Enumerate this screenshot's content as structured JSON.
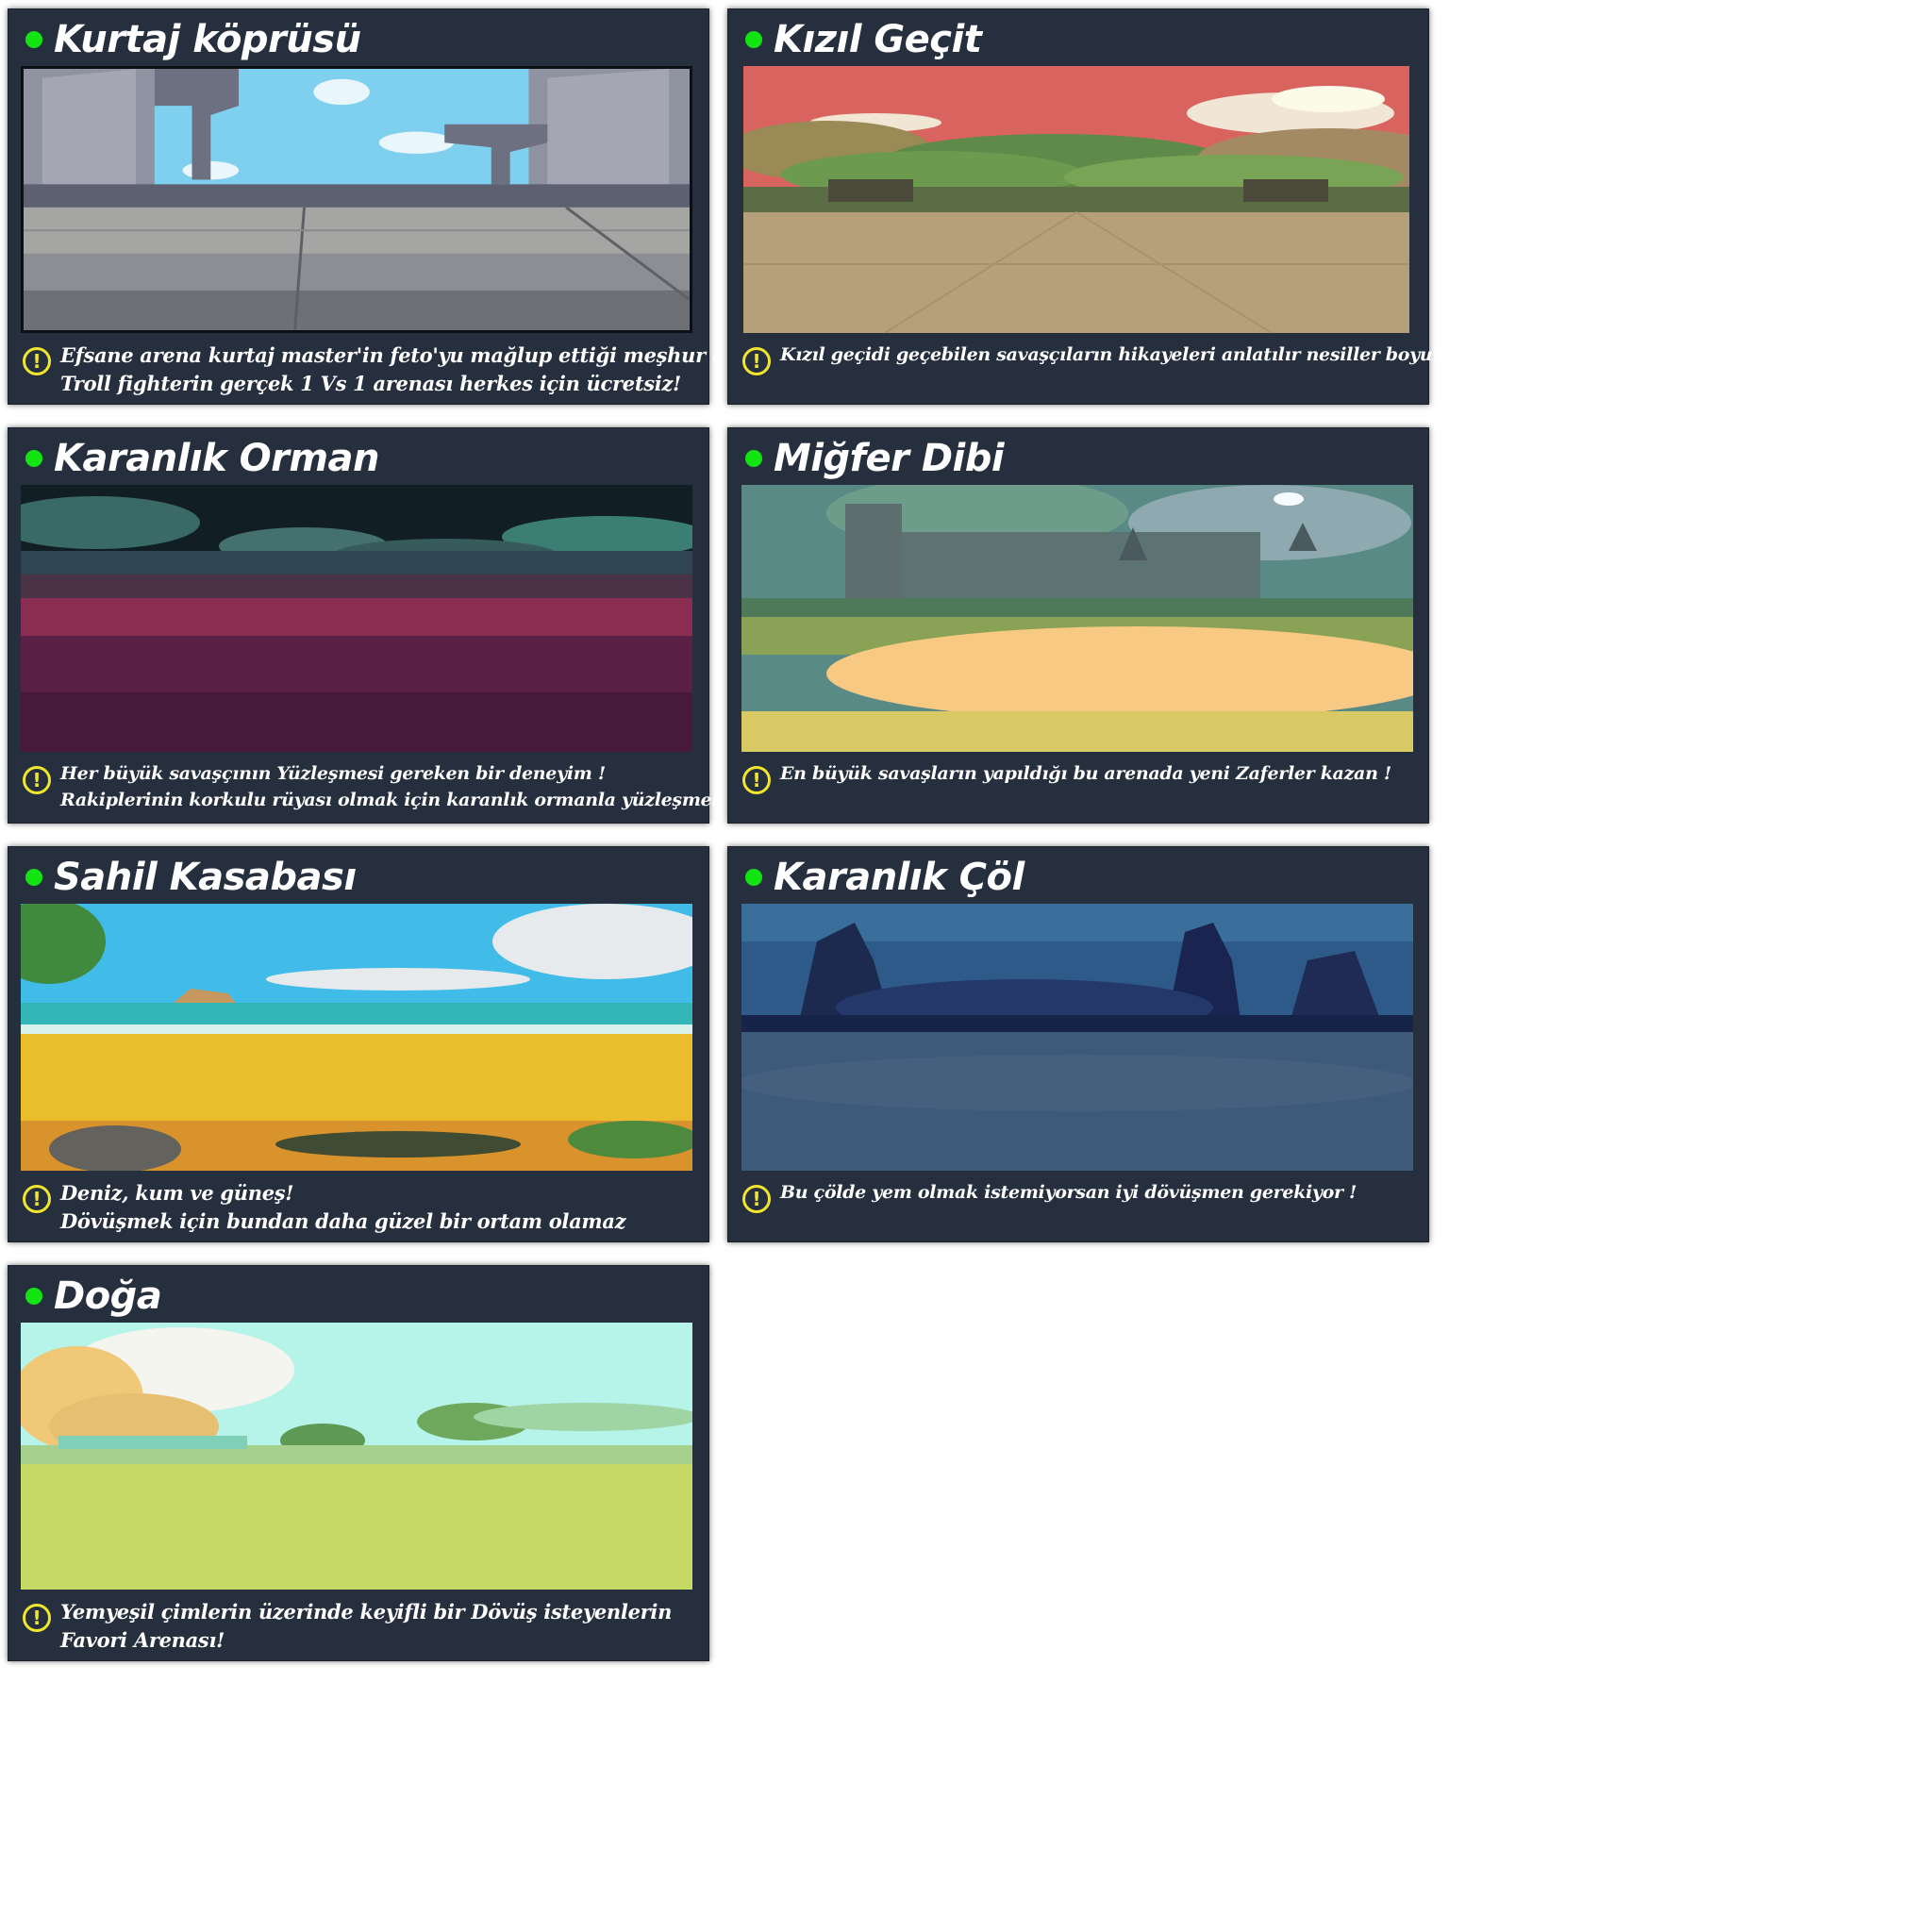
{
  "arenas": [
    {
      "title": "Kurtaj köprüsü",
      "status": "active",
      "desc": [
        "Efsane arena kurtaj master'in feto'yu mağlup ettiği meşhur alan",
        "Troll fighterin gerçek 1 Vs 1 arenası herkes için ücretsiz!"
      ]
    },
    {
      "title": "Kızıl Geçit",
      "status": "active",
      "desc": [
        "Kızıl geçidi geçebilen savaşçıların hikayeleri anlatılır nesiller boyu!"
      ]
    },
    {
      "title": "Karanlık Orman",
      "status": "active",
      "desc": [
        "Her büyük savaşçının Yüzleşmesi gereken bir deneyim !",
        "Rakiplerinin korkulu rüyası olmak için karanlık ormanla yüzleşmelisin!"
      ]
    },
    {
      "title": "Miğfer Dibi",
      "status": "active",
      "desc": [
        "En büyük savaşların yapıldığı bu arenada yeni Zaferler kazan !"
      ]
    },
    {
      "title": "Sahil Kasabası",
      "status": "active",
      "desc": [
        "Deniz, kum ve güneş!",
        "Dövüşmek için bundan daha güzel bir ortam olamaz"
      ]
    },
    {
      "title": "Karanlık Çöl",
      "status": "active",
      "desc": [
        "Bu çölde yem olmak istemiyorsan iyi dövüşmen gerekiyor !"
      ]
    },
    {
      "title": "Doğa",
      "status": "active",
      "desc": [
        "Yemyeşil çimlerin üzerinde keyifli bir Dövüş isteyenlerin",
        "Favori Arenası!"
      ]
    }
  ],
  "icons": {
    "status": "status-dot-icon",
    "warning": "warning-icon"
  },
  "colors": {
    "card_bg": "#252f3d",
    "status_dot": "#12e412",
    "warning": "#f2e530"
  }
}
